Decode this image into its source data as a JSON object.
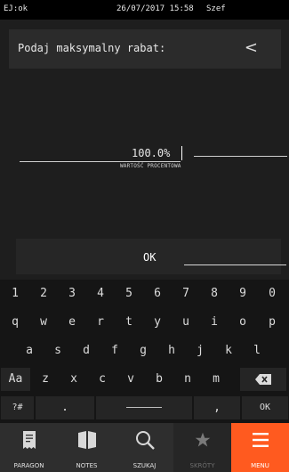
{
  "statusbar": {
    "left": "EJ:ok",
    "datetime": "26/07/2017  15:58",
    "user": "Szef"
  },
  "header": {
    "title": "Podaj maksymalny rabat:",
    "back_icon": "<"
  },
  "field": {
    "value": "100.0%",
    "label": "WARTOŚĆ PROCENTOWA"
  },
  "ok_button": {
    "label": "OK"
  },
  "keyboard": {
    "row1": [
      "1",
      "2",
      "3",
      "4",
      "5",
      "6",
      "7",
      "8",
      "9",
      "0"
    ],
    "row2": [
      "q",
      "w",
      "e",
      "r",
      "t",
      "y",
      "u",
      "i",
      "o",
      "p"
    ],
    "row3": [
      "a",
      "s",
      "d",
      "f",
      "g",
      "h",
      "j",
      "k",
      "l"
    ],
    "row4": [
      "Aa",
      "z",
      "x",
      "c",
      "v",
      "b",
      "n",
      "m"
    ],
    "row5": {
      "symbols": "?#",
      "dot": ".",
      "comma": ",",
      "ok": "OK"
    }
  },
  "nav": [
    {
      "label": "PARAGON",
      "icon": "receipt-icon"
    },
    {
      "label": "NOTES",
      "icon": "notebook-icon"
    },
    {
      "label": "SZUKAJ",
      "icon": "search-icon"
    },
    {
      "label": "SKRÓTY",
      "icon": "star-icon"
    },
    {
      "label": "MENU",
      "icon": "menu-icon"
    }
  ],
  "colors": {
    "accent": "#ff5a1f",
    "background": "#1e1e1e"
  }
}
